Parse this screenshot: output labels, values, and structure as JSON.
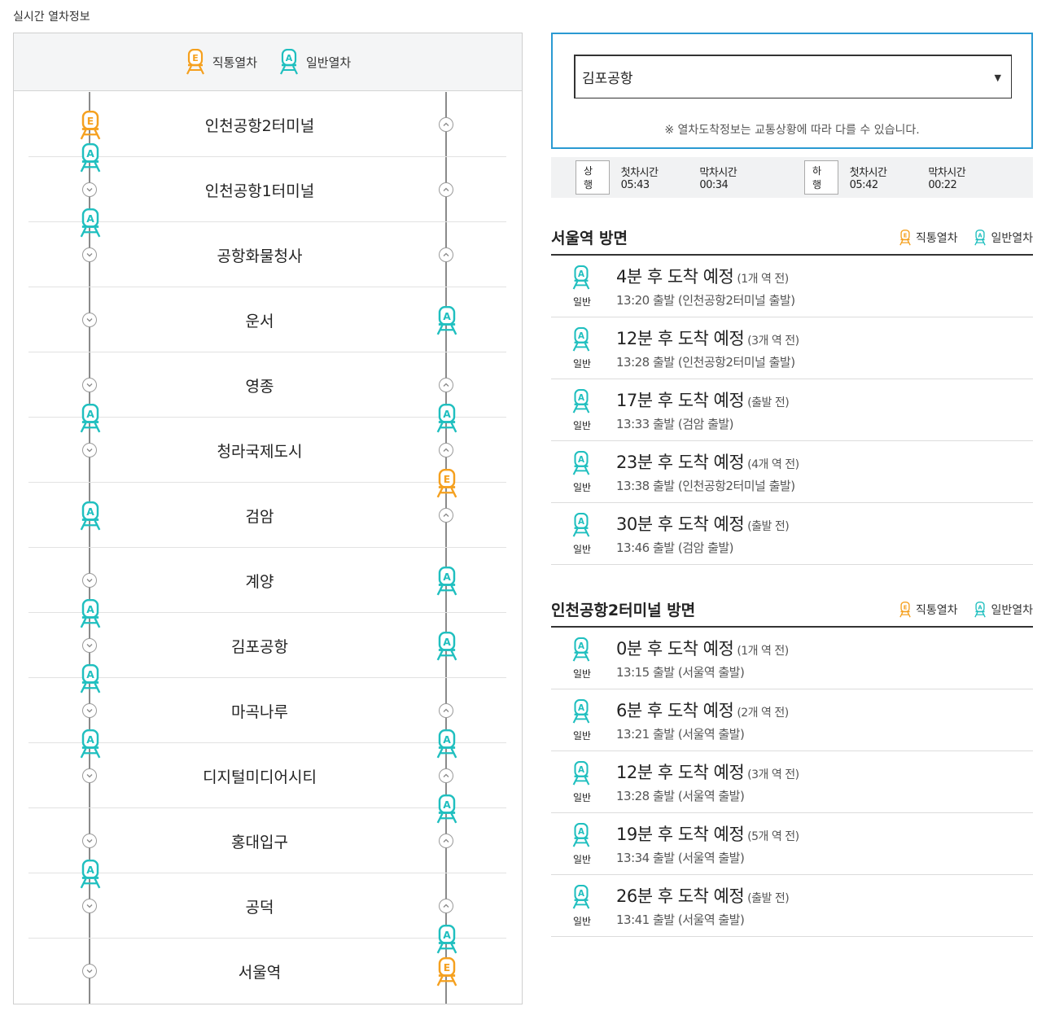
{
  "page_title": "실시간 열차정보",
  "legend": {
    "express": "직통열차",
    "normal": "일반열차"
  },
  "colors": {
    "express": "#f5a01e",
    "normal": "#1fbfbf",
    "accent": "#2a9ad2",
    "track": "#8a8a8a"
  },
  "icons": {
    "express_letter": "E",
    "normal_letter": "A",
    "up_marker": "chevron-up-icon",
    "down_marker": "chevron-down-icon"
  },
  "stations": [
    {
      "name": "인천공항2터미널",
      "left_marker": false,
      "right_marker": true
    },
    {
      "name": "인천공항1터미널",
      "left_marker": true,
      "right_marker": true
    },
    {
      "name": "공항화물청사",
      "left_marker": true,
      "right_marker": true
    },
    {
      "name": "운서",
      "left_marker": true,
      "right_marker": false
    },
    {
      "name": "영종",
      "left_marker": true,
      "right_marker": true
    },
    {
      "name": "청라국제도시",
      "left_marker": true,
      "right_marker": true
    },
    {
      "name": "검암",
      "left_marker": false,
      "right_marker": true
    },
    {
      "name": "계양",
      "left_marker": true,
      "right_marker": false
    },
    {
      "name": "김포공항",
      "left_marker": true,
      "right_marker": false
    },
    {
      "name": "마곡나루",
      "left_marker": true,
      "right_marker": true
    },
    {
      "name": "디지털미디어시티",
      "left_marker": true,
      "right_marker": true
    },
    {
      "name": "홍대입구",
      "left_marker": true,
      "right_marker": true
    },
    {
      "name": "공덕",
      "left_marker": true,
      "right_marker": true
    },
    {
      "name": "서울역",
      "left_marker": true,
      "right_marker": false
    }
  ],
  "trains_left": [
    {
      "type": "express",
      "station_index": 0,
      "between": false
    },
    {
      "type": "normal",
      "station_index": 0,
      "between": true
    },
    {
      "type": "normal",
      "station_index": 1,
      "between": true
    },
    {
      "type": "normal",
      "station_index": 4,
      "between": true
    },
    {
      "type": "normal",
      "station_index": 6,
      "between": false
    },
    {
      "type": "normal",
      "station_index": 7,
      "between": true
    },
    {
      "type": "normal",
      "station_index": 8,
      "between": true
    },
    {
      "type": "normal",
      "station_index": 9,
      "between": true
    },
    {
      "type": "normal",
      "station_index": 11,
      "between": true
    }
  ],
  "trains_right": [
    {
      "type": "normal",
      "station_index": 3,
      "between": false
    },
    {
      "type": "normal",
      "station_index": 4,
      "between": true
    },
    {
      "type": "express",
      "station_index": 5,
      "between": true
    },
    {
      "type": "normal",
      "station_index": 7,
      "between": false
    },
    {
      "type": "normal",
      "station_index": 8,
      "between": false
    },
    {
      "type": "normal",
      "station_index": 9,
      "between": true
    },
    {
      "type": "normal",
      "station_index": 10,
      "between": true
    },
    {
      "type": "normal",
      "station_index": 12,
      "between": true
    },
    {
      "type": "express",
      "station_index": 13,
      "between": false
    }
  ],
  "station_select": {
    "value": "김포공항"
  },
  "notice": "※ 열차도착정보는 교통상황에 따라 다를 수 있습니다.",
  "timetable": {
    "up": {
      "label": "상행",
      "first": "첫차시간 05:43",
      "last": "막차시간 00:34"
    },
    "down": {
      "label": "하행",
      "first": "첫차시간 05:42",
      "last": "막차시간 00:22"
    }
  },
  "sections": [
    {
      "title": "서울역 방면",
      "arrivals": [
        {
          "type_label": "일반",
          "eta": "4분 후 도착 예정",
          "sub": "(1개 역 전)",
          "departure": "13:20 출발 (인천공항2터미널 출발)"
        },
        {
          "type_label": "일반",
          "eta": "12분 후 도착 예정",
          "sub": "(3개 역 전)",
          "departure": "13:28 출발 (인천공항2터미널 출발)"
        },
        {
          "type_label": "일반",
          "eta": "17분 후 도착 예정",
          "sub": "(출발 전)",
          "departure": "13:33 출발 (검암 출발)"
        },
        {
          "type_label": "일반",
          "eta": "23분 후 도착 예정",
          "sub": "(4개 역 전)",
          "departure": "13:38 출발 (인천공항2터미널 출발)"
        },
        {
          "type_label": "일반",
          "eta": "30분 후 도착 예정",
          "sub": "(출발 전)",
          "departure": "13:46 출발 (검암 출발)"
        }
      ]
    },
    {
      "title": "인천공항2터미널 방면",
      "arrivals": [
        {
          "type_label": "일반",
          "eta": "0분 후 도착 예정",
          "sub": "(1개 역 전)",
          "departure": "13:15 출발 (서울역 출발)"
        },
        {
          "type_label": "일반",
          "eta": "6분 후 도착 예정",
          "sub": "(2개 역 전)",
          "departure": "13:21 출발 (서울역 출발)"
        },
        {
          "type_label": "일반",
          "eta": "12분 후 도착 예정",
          "sub": "(3개 역 전)",
          "departure": "13:28 출발 (서울역 출발)"
        },
        {
          "type_label": "일반",
          "eta": "19분 후 도착 예정",
          "sub": "(5개 역 전)",
          "departure": "13:34 출발 (서울역 출발)"
        },
        {
          "type_label": "일반",
          "eta": "26분 후 도착 예정",
          "sub": "(출발 전)",
          "departure": "13:41 출발 (서울역 출발)"
        }
      ]
    }
  ]
}
